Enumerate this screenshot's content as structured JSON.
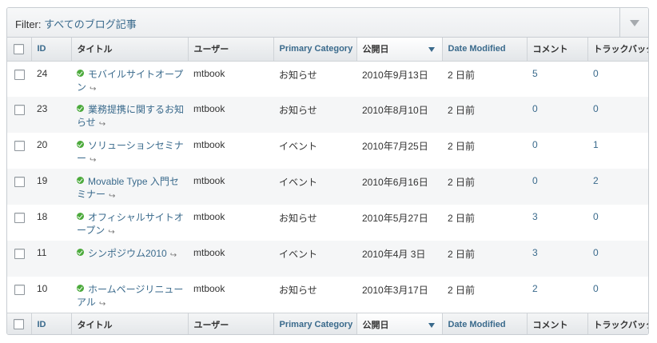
{
  "filter": {
    "label": "Filter:",
    "value": "すべてのブログ記事"
  },
  "columns": {
    "id": "ID",
    "title": "タイトル",
    "user": "ユーザー",
    "primary_category": "Primary Category",
    "published": "公開日",
    "date_modified": "Date Modified",
    "comments": "コメント",
    "trackbacks": "トラックバック"
  },
  "rows": [
    {
      "id": "24",
      "title": "モバイルサイトオープン",
      "user": "mtbook",
      "category": "お知らせ",
      "published": "2010年9月13日",
      "modified": "2 日前",
      "comments": "5",
      "trackbacks": "0"
    },
    {
      "id": "23",
      "title": "業務提携に関するお知らせ",
      "user": "mtbook",
      "category": "お知らせ",
      "published": "2010年8月10日",
      "modified": "2 日前",
      "comments": "0",
      "trackbacks": "0"
    },
    {
      "id": "20",
      "title": "ソリューションセミナー",
      "user": "mtbook",
      "category": "イベント",
      "published": "2010年7月25日",
      "modified": "2 日前",
      "comments": "0",
      "trackbacks": "1"
    },
    {
      "id": "19",
      "title": "Movable Type 入門セミナー",
      "user": "mtbook",
      "category": "イベント",
      "published": "2010年6月16日",
      "modified": "2 日前",
      "comments": "0",
      "trackbacks": "2"
    },
    {
      "id": "18",
      "title": "オフィシャルサイトオープン",
      "user": "mtbook",
      "category": "お知らせ",
      "published": "2010年5月27日",
      "modified": "2 日前",
      "comments": "3",
      "trackbacks": "0"
    },
    {
      "id": "11",
      "title": "シンポジウム2010",
      "user": "mtbook",
      "category": "イベント",
      "published": "2010年4月 3日",
      "modified": "2 日前",
      "comments": "3",
      "trackbacks": "0"
    },
    {
      "id": "10",
      "title": "ホームページリニューアル",
      "user": "mtbook",
      "category": "お知らせ",
      "published": "2010年3月17日",
      "modified": "2 日前",
      "comments": "2",
      "trackbacks": "0"
    }
  ],
  "icons": {
    "status": "published-check-icon",
    "view": "view-entry-icon",
    "filter_toggle": "chevron-down-icon"
  },
  "colors": {
    "link": "#3a6a8c",
    "status_green": "#4caa3c"
  }
}
